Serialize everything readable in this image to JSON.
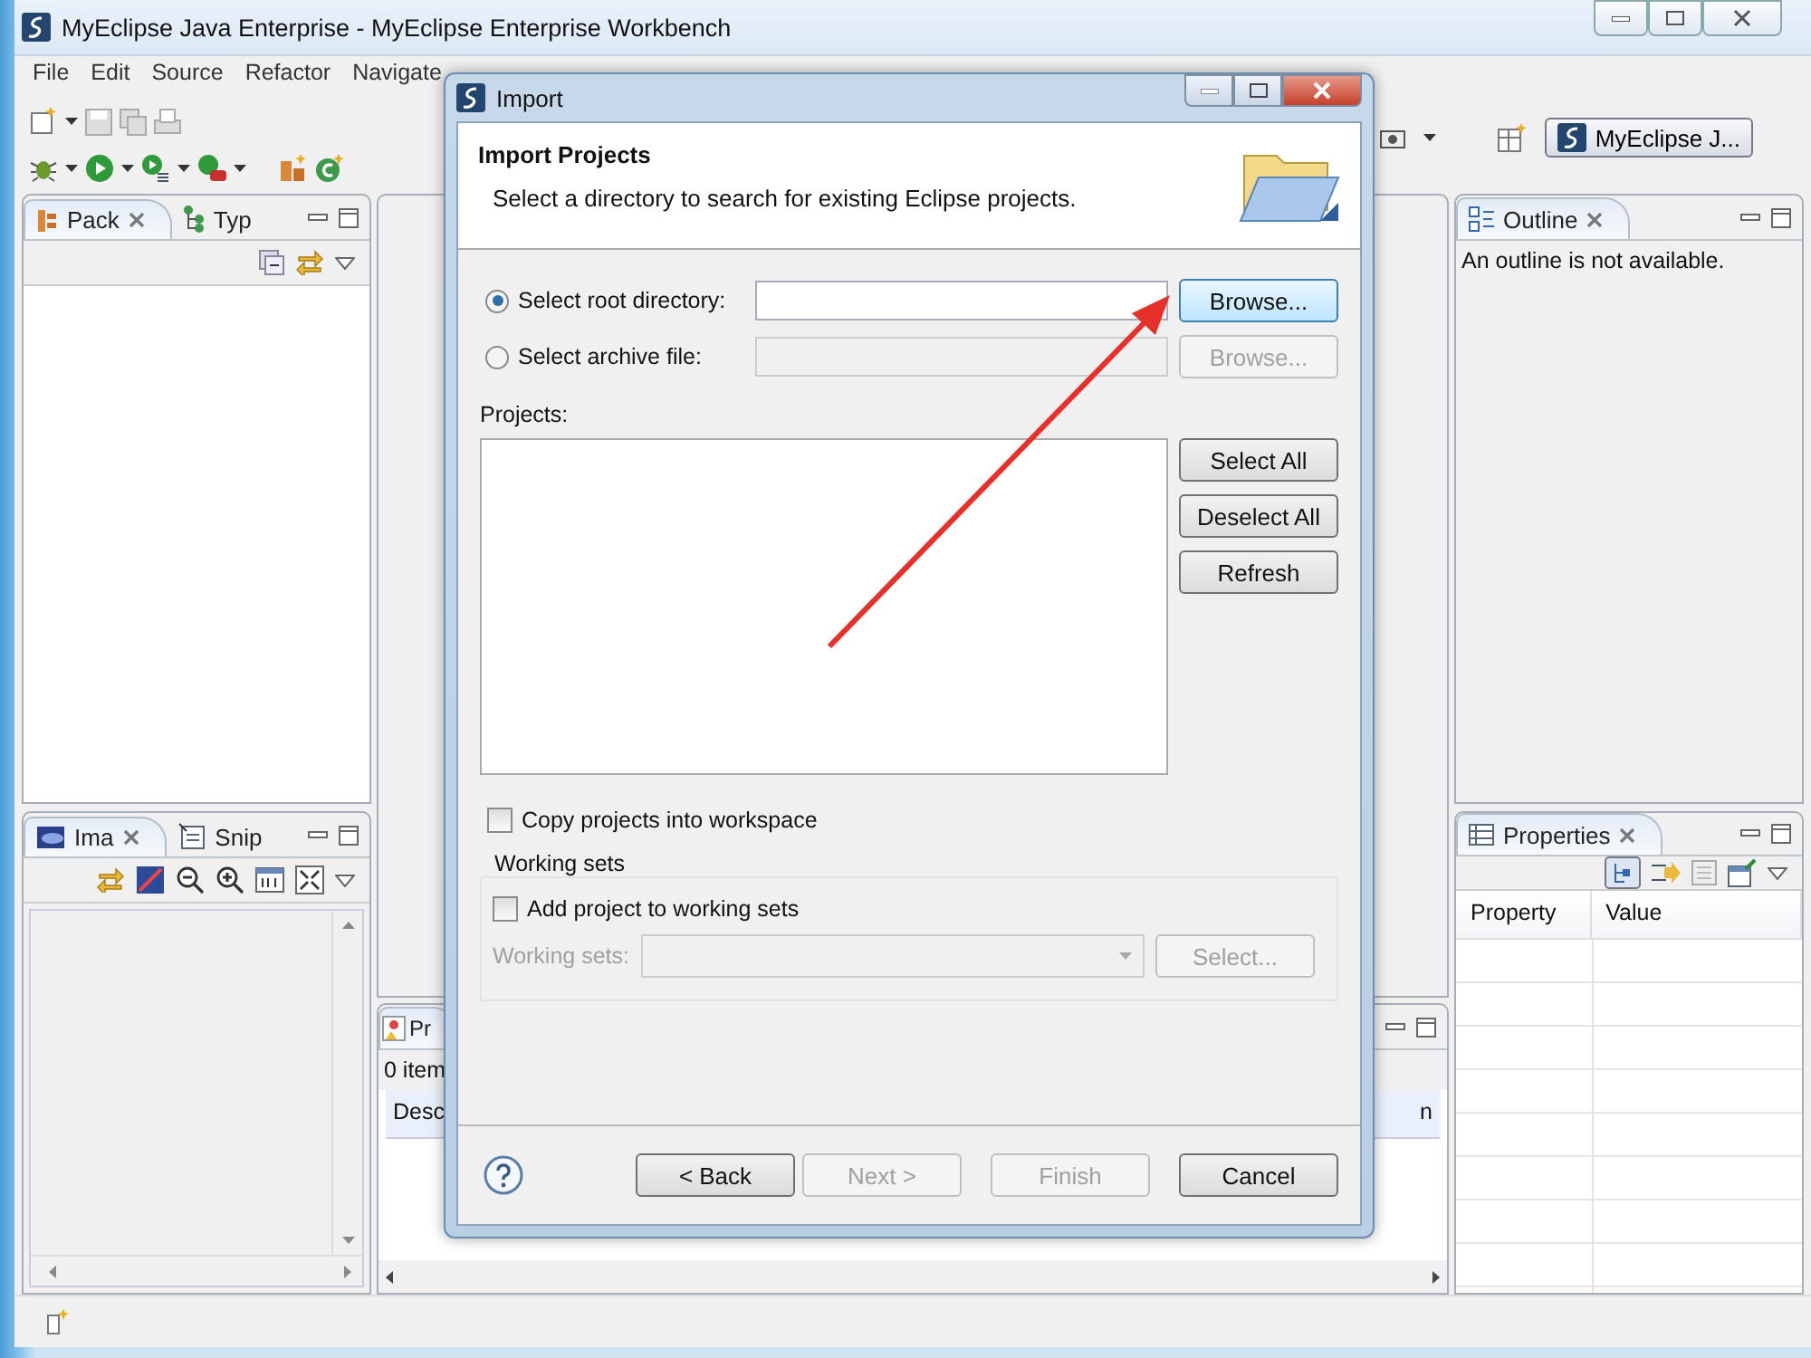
{
  "window": {
    "title": "MyEclipse Java Enterprise - MyEclipse Enterprise Workbench"
  },
  "menu": [
    "File",
    "Edit",
    "Source",
    "Refactor",
    "Navigate"
  ],
  "perspective": {
    "label": "MyEclipse J..."
  },
  "left_top_panel": {
    "tabs": [
      {
        "label": "Pack",
        "selected": true
      },
      {
        "label": "Typ",
        "selected": false
      }
    ]
  },
  "left_bottom_panel": {
    "tabs": [
      {
        "label": "Ima",
        "selected": true
      },
      {
        "label": "Snip",
        "selected": false
      }
    ]
  },
  "bottom_panel": {
    "tab": "Pr",
    "status": "0 item",
    "columns": [
      "Desc",
      "n"
    ]
  },
  "outline": {
    "title": "Outline",
    "message": "An outline is not available."
  },
  "properties": {
    "title": "Properties",
    "columns": [
      "Property",
      "Value"
    ]
  },
  "dialog": {
    "title": "Import",
    "heading": "Import Projects",
    "description": "Select a directory to search for existing Eclipse projects.",
    "sources": [
      {
        "label": "Select root directory:",
        "selected": true,
        "button": "Browse...",
        "disabled": false
      },
      {
        "label": "Select archive file:",
        "selected": false,
        "button": "Browse...",
        "disabled": true
      }
    ],
    "projects_label": "Projects:",
    "list_buttons": [
      "Select All",
      "Deselect All",
      "Refresh"
    ],
    "copy_option": {
      "label": "Copy projects into workspace",
      "checked": false
    },
    "working_sets": {
      "title": "Working sets",
      "option": {
        "label": "Add project to working sets",
        "checked": false
      },
      "field_label": "Working sets:",
      "button": "Select...",
      "disabled": true
    },
    "buttons": [
      {
        "label": "< Back",
        "disabled": false
      },
      {
        "label": "Next >",
        "disabled": true
      },
      {
        "label": "Finish",
        "disabled": true
      },
      {
        "label": "Cancel",
        "disabled": false
      }
    ]
  }
}
